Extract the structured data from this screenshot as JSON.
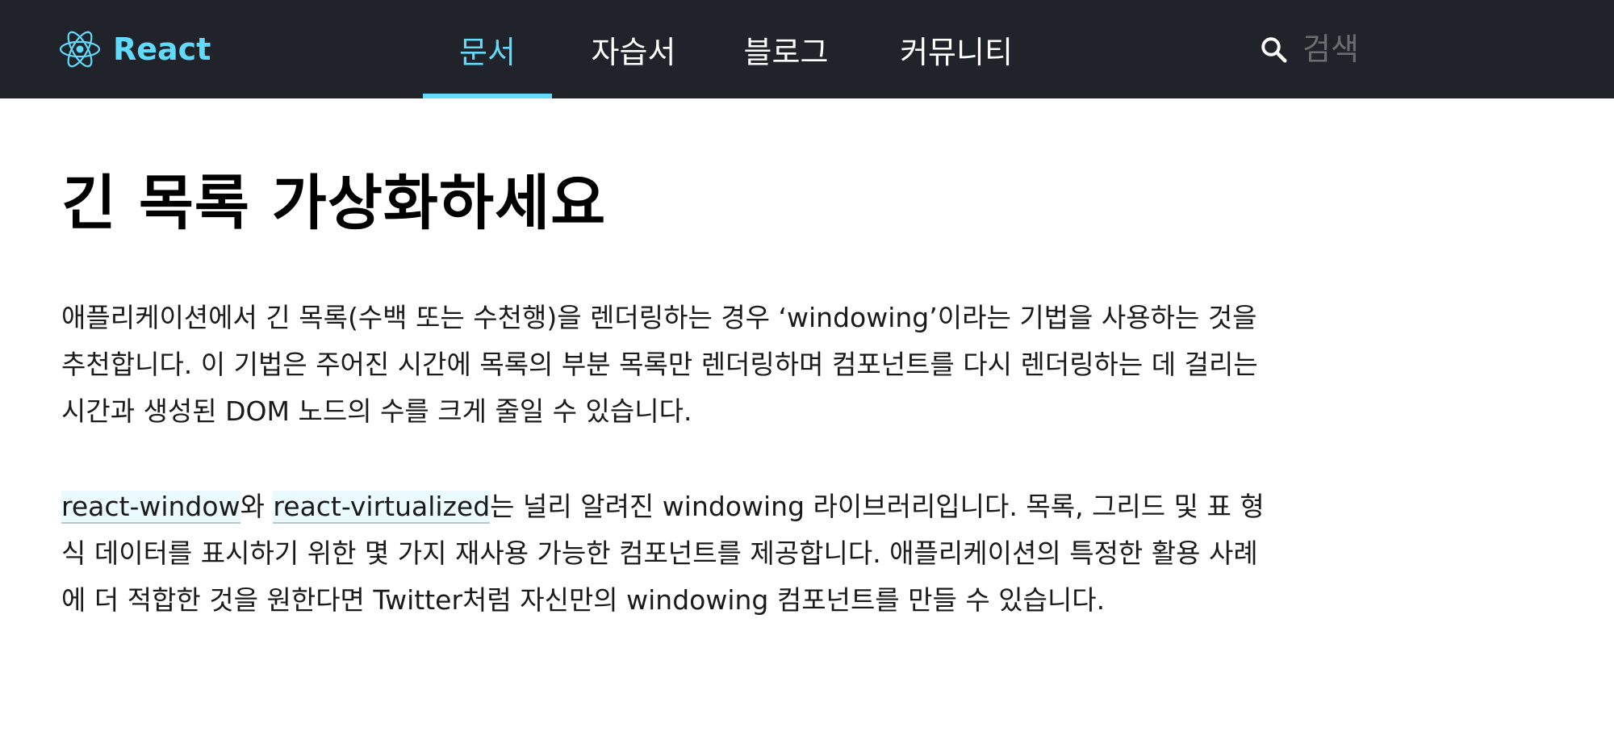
{
  "header": {
    "logo_text": "React",
    "nav": [
      {
        "label": "문서",
        "active": true
      },
      {
        "label": "자습서",
        "active": false
      },
      {
        "label": "블로그",
        "active": false
      },
      {
        "label": "커뮤니티",
        "active": false
      }
    ],
    "search_placeholder": "검색"
  },
  "colors": {
    "header_bg": "#20232a",
    "brand": "#61dafb",
    "text": "#1a1a1a"
  },
  "main": {
    "title": "긴 목록 가상화하세요",
    "p1": "애플리케이션에서 긴 목록(수백 또는 수천행)을 렌더링하는 경우 ‘windowing’이라는 기법을 사용하는 것을 추천합니다. 이 기법은 주어진 시간에 목록의 부분 목록만 렌더링하며 컴포넌트를 다시 렌더링하는 데 걸리는 시간과 생성된 DOM 노드의 수를 크게 줄일 수 있습니다.",
    "p2": {
      "link1": "react-window",
      "text1": "와 ",
      "link2": "react-virtualized",
      "text2": "는 널리 알려진 windowing 라이브러리입니다. 목록, 그리드 및 표 형식 데이터를 표시하기 위한 몇 가지 재사용 가능한 컴포넌트를 제공합니다. 애플리케이션의 특정한 활용 사례에 더 적합한 것을 원한다면 Twitter처럼 자신만의 windowing 컴포넌트를 만들 수 있습니다."
    }
  }
}
